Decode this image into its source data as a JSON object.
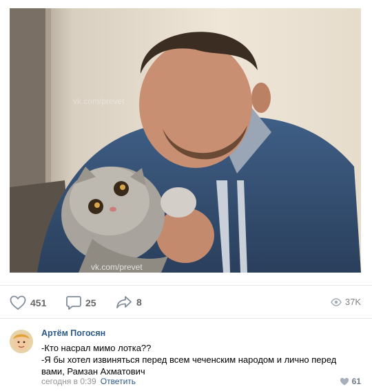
{
  "post": {
    "watermark_top": "vk.com/prevet",
    "watermark_bottom": "vk.com/prevet",
    "likes": "451",
    "comments": "25",
    "shares": "8",
    "views": "37K"
  },
  "comment": {
    "author": "Артём Погосян",
    "line1": "-Кто насрал мимо лотка??",
    "line2": "-Я бы хотел извиняться перед всем чеченским народом и лично перед вами, Рамзан Ахматович",
    "time": "сегодня в 0:39",
    "reply_label": "Ответить",
    "likes": "61"
  },
  "colors": {
    "link": "#2a5885",
    "icon": "#818c99",
    "divider": "#e7e8ec"
  }
}
